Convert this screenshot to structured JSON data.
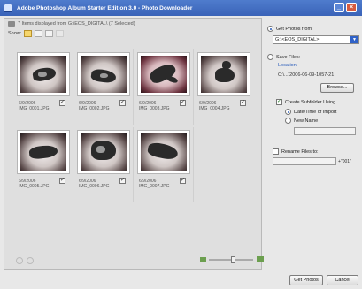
{
  "window": {
    "title": "Adobe Photoshop Album Starter Edition 3.0 - Photo Downloader"
  },
  "left_panel": {
    "info": "7 Items displayed from G:\\EOS_DIGITAL\\ (7 Selected)",
    "show_label": "Show:",
    "items": [
      {
        "date": "6/9/2006",
        "file": "IMG_0001.JPG",
        "checked": true
      },
      {
        "date": "6/9/2006",
        "file": "IMG_0002.JPG",
        "checked": true
      },
      {
        "date": "6/9/2006",
        "file": "IMG_0003.JPG",
        "checked": true
      },
      {
        "date": "6/9/2006",
        "file": "IMG_0004.JPG",
        "checked": true
      },
      {
        "date": "6/9/2006",
        "file": "IMG_0005.JPG",
        "checked": true
      },
      {
        "date": "6/9/2006",
        "file": "IMG_0006.JPG",
        "checked": true
      },
      {
        "date": "6/9/2006",
        "file": "IMG_0007.JPG",
        "checked": true
      }
    ],
    "zoom_level": 0.55
  },
  "right_panel": {
    "get_photos_label": "Get Photos from:",
    "source_value": "G:\\<EOS_DIGITAL>",
    "save_files_label": "Save Files:",
    "location_label": "Location",
    "location_path": "C:\\...\\2006-06-09-1057-21",
    "browse_label": "Browse...",
    "create_subfolder_label": "Create Subfolder Using",
    "subfolder_option_1": "Date/Time of Import",
    "subfolder_option_2": "New Name",
    "rename_label": "Rename Files to:",
    "rename_suffix": "+\"001\""
  },
  "footer": {
    "get_photos_button": "Get Photos",
    "cancel_button": "Cancel"
  },
  "colors": {
    "titlebar": "#3a63b8",
    "accent": "#2a5cba"
  }
}
